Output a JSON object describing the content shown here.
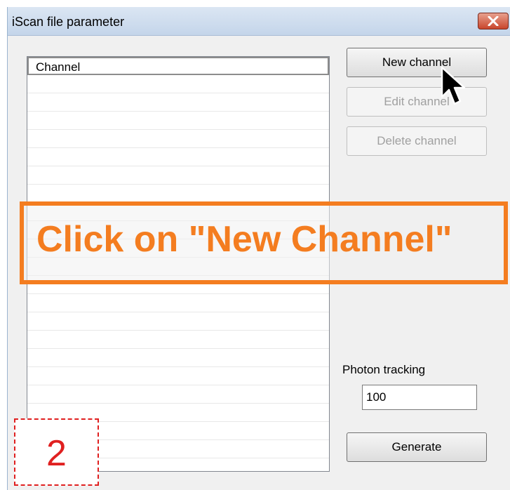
{
  "window": {
    "title": "iScan file parameter"
  },
  "list": {
    "column_header": "Channel"
  },
  "buttons": {
    "new_channel": "New channel",
    "edit_channel": "Edit channel",
    "delete_channel": "Delete channel",
    "generate": "Generate"
  },
  "photon_tracking": {
    "label": "Photon tracking",
    "value": "100"
  },
  "overlay": {
    "instruction": "Click on \"New Channel\"",
    "step_number": "2"
  },
  "colors": {
    "accent": "#f47d20",
    "step": "#e02020"
  },
  "icons": [
    "close-icon",
    "mouse-cursor-icon"
  ]
}
